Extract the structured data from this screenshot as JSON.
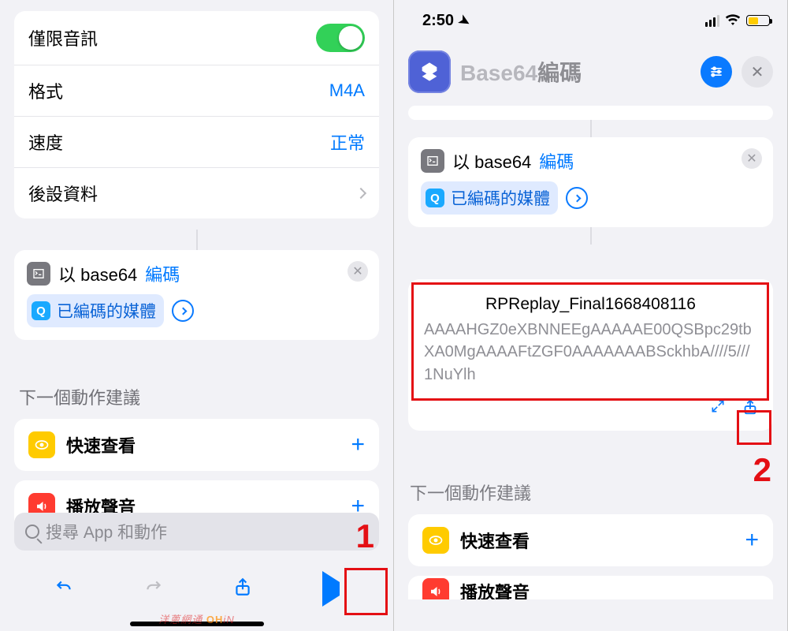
{
  "left": {
    "settings": {
      "audio_only": "僅限音訊",
      "format_label": "格式",
      "format_value": "M4A",
      "speed_label": "速度",
      "speed_value": "正常",
      "metadata_label": "後設資料"
    },
    "encode_action": {
      "prefix": "以 base64",
      "link": "編碼",
      "pill": "已編碼的媒體"
    },
    "section": "下一個動作建議",
    "suggestions": {
      "quicklook": "快速查看",
      "play_sound": "播放聲音"
    },
    "search_placeholder": "搜尋 App 和動作",
    "annotation_num": "1"
  },
  "right": {
    "status_time": "2:50",
    "title_gray": "Base64",
    "title_dark": "編碼",
    "encode_action": {
      "prefix": "以 base64",
      "link": "編碼",
      "pill": "已編碼的媒體"
    },
    "result": {
      "title": "RPReplay_Final1668408116",
      "body": "AAAAHGZ0eXBNNEEgAAAAAE00QSBpc29tbXA0MgAAAAFtZGF0AAAAAAABSckhbA////5///1NuYlh"
    },
    "section": "下一個動作建議",
    "suggestions": {
      "quicklook": "快速查看",
      "play_sound": "播放聲音"
    },
    "annotation_num": "2"
  },
  "watermark": "洋蔥網通 OHiN"
}
